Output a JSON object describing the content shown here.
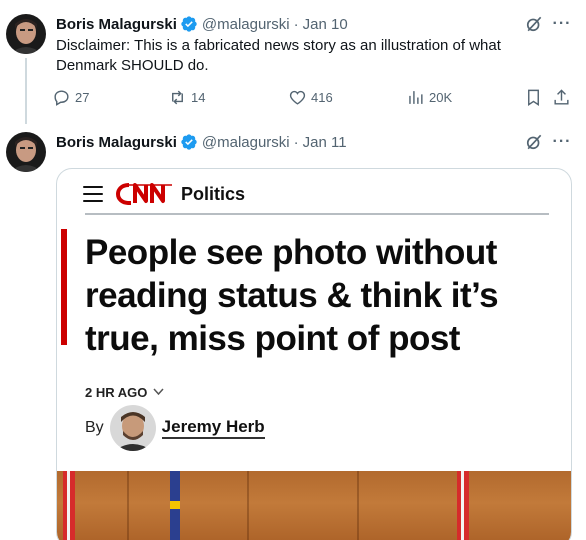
{
  "tweets": [
    {
      "name": "Boris Malagurski",
      "handle": "@malagurski",
      "separator": "·",
      "date": "Jan 10",
      "text_lines": [
        "Disclaimer: This is a fabricated news story as an illustration of what",
        "Denmark SHOULD do."
      ],
      "stats": {
        "replies": "27",
        "retweets": "14",
        "likes": "416",
        "views": "20K"
      }
    },
    {
      "name": "Boris Malagurski",
      "handle": "@malagurski",
      "separator": "·",
      "date": "Jan 11",
      "card": {
        "section": "Politics",
        "headline_lines": [
          "People see photo without",
          "reading status & think it’s",
          "true, miss point of post"
        ],
        "timestamp": "2 HR AGO",
        "by": "By",
        "author": "Jeremy Herb"
      }
    }
  ],
  "icons": {
    "verified": "verified-badge-icon",
    "grok": "grok-icon",
    "more": "more-icon",
    "reply": "reply-icon",
    "retweet": "retweet-icon",
    "like": "heart-icon",
    "views": "views-icon",
    "bookmark": "bookmark-icon",
    "share": "share-icon",
    "menu": "hamburger-icon",
    "logo": "cnn-logo"
  },
  "colors": {
    "verified": "#1d9bf0",
    "text_secondary": "#536471",
    "cnn_red": "#cc0000"
  },
  "more_glyph": "···"
}
